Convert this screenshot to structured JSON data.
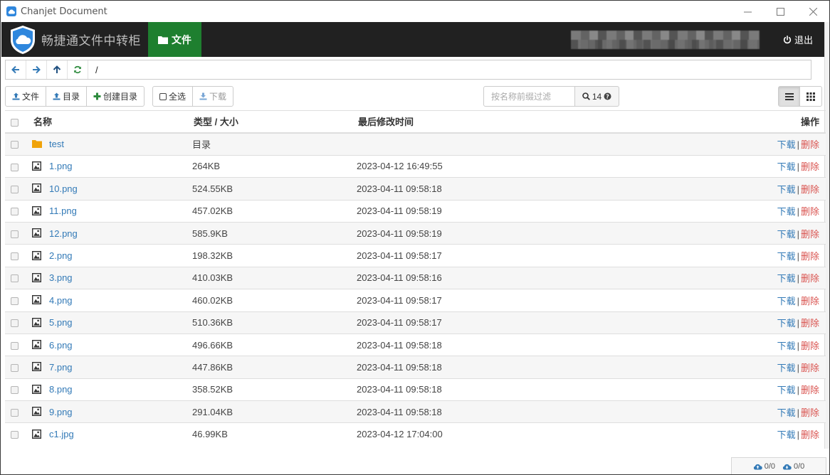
{
  "window": {
    "title": "Chanjet Document"
  },
  "header": {
    "brand": "畅捷通文件中转柜",
    "nav_tab": "文件",
    "logout": "退出"
  },
  "address": {
    "path": "/"
  },
  "toolbar": {
    "upload_file": "文件",
    "upload_dir": "目录",
    "create_dir": "创建目录",
    "select_all": "全选",
    "download": "下载",
    "filter_placeholder": "按名称前缀过滤",
    "count": "14"
  },
  "table": {
    "headers": {
      "name": "名称",
      "size": "类型 / 大小",
      "time": "最后修改时间",
      "op": "操作"
    },
    "op_download": "下载",
    "op_sep": "|",
    "op_delete": "删除",
    "rows": [
      {
        "name": "test",
        "type": "folder",
        "size": "目录",
        "time": ""
      },
      {
        "name": "1.png",
        "type": "image",
        "size": "264KB",
        "time": "2023-04-12 16:49:55"
      },
      {
        "name": "10.png",
        "type": "image",
        "size": "524.55KB",
        "time": "2023-04-11 09:58:18"
      },
      {
        "name": "11.png",
        "type": "image",
        "size": "457.02KB",
        "time": "2023-04-11 09:58:19"
      },
      {
        "name": "12.png",
        "type": "image",
        "size": "585.9KB",
        "time": "2023-04-11 09:58:19"
      },
      {
        "name": "2.png",
        "type": "image",
        "size": "198.32KB",
        "time": "2023-04-11 09:58:17"
      },
      {
        "name": "3.png",
        "type": "image",
        "size": "410.03KB",
        "time": "2023-04-11 09:58:16"
      },
      {
        "name": "4.png",
        "type": "image",
        "size": "460.02KB",
        "time": "2023-04-11 09:58:17"
      },
      {
        "name": "5.png",
        "type": "image",
        "size": "510.36KB",
        "time": "2023-04-11 09:58:17"
      },
      {
        "name": "6.png",
        "type": "image",
        "size": "496.66KB",
        "time": "2023-04-11 09:58:18"
      },
      {
        "name": "7.png",
        "type": "image",
        "size": "447.86KB",
        "time": "2023-04-11 09:58:18"
      },
      {
        "name": "8.png",
        "type": "image",
        "size": "358.52KB",
        "time": "2023-04-11 09:58:18"
      },
      {
        "name": "9.png",
        "type": "image",
        "size": "291.04KB",
        "time": "2023-04-11 09:58:18"
      },
      {
        "name": "c1.jpg",
        "type": "image",
        "size": "46.99KB",
        "time": "2023-04-12 17:04:00"
      }
    ]
  },
  "status": {
    "upload_count": "0/0",
    "download_count": "0/0"
  },
  "colors": {
    "header_bg": "#212121",
    "nav_active": "#1e7f2f",
    "link": "#337ab7",
    "delete": "#d9534f",
    "folder": "#f0a30a"
  }
}
